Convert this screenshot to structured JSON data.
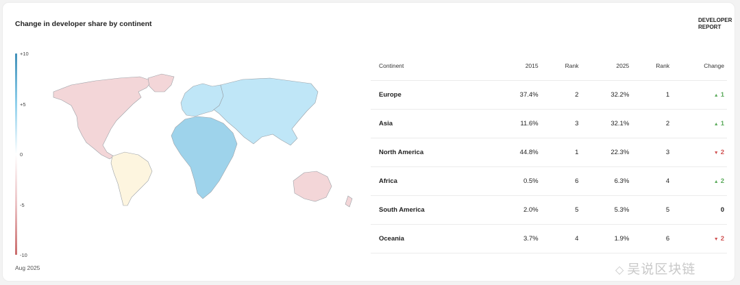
{
  "header": {
    "title": "Change in developer share by continent",
    "brand_line1": "DEVELOPER",
    "brand_line2": "REPORT"
  },
  "legend": {
    "ticks": [
      {
        "label": "+10",
        "value": 10
      },
      {
        "label": "+5",
        "value": 5
      },
      {
        "label": "0",
        "value": 0
      },
      {
        "label": "-5",
        "value": -5
      },
      {
        "label": "-10",
        "value": -10
      }
    ],
    "colors": {
      "positive": "#3f8fb8",
      "neutral": "#ffffff",
      "negative": "#c96a6a"
    }
  },
  "footer": {
    "date": "Aug 2025"
  },
  "watermark": {
    "text": "吴说区块链"
  },
  "chart_data": {
    "type": "table",
    "map_type": "choropleth",
    "columns": [
      "Continent",
      "2015",
      "Rank",
      "2025",
      "Rank",
      "Change"
    ],
    "rows": [
      {
        "continent": "Europe",
        "share_2015": "37.4%",
        "rank_2015": "2",
        "share_2025": "32.2%",
        "rank_2025": "1",
        "change": "1",
        "direction": "up",
        "fill": "#bfe6f7"
      },
      {
        "continent": "Asia",
        "share_2015": "11.6%",
        "rank_2015": "3",
        "share_2025": "32.1%",
        "rank_2025": "2",
        "change": "1",
        "direction": "up",
        "fill": "#bfe6f7"
      },
      {
        "continent": "North America",
        "share_2015": "44.8%",
        "rank_2015": "1",
        "share_2025": "22.3%",
        "rank_2025": "3",
        "change": "2",
        "direction": "down",
        "fill": "#f3d6d8"
      },
      {
        "continent": "Africa",
        "share_2015": "0.5%",
        "rank_2015": "6",
        "share_2025": "6.3%",
        "rank_2025": "4",
        "change": "2",
        "direction": "up",
        "fill": "#9ed3eb"
      },
      {
        "continent": "South America",
        "share_2015": "2.0%",
        "rank_2015": "5",
        "share_2025": "5.3%",
        "rank_2025": "5",
        "change": "0",
        "direction": "flat",
        "fill": "#fdf5df"
      },
      {
        "continent": "Oceania",
        "share_2015": "3.7%",
        "rank_2015": "4",
        "share_2025": "1.9%",
        "rank_2025": "6",
        "change": "2",
        "direction": "down",
        "fill": "#f3d6d8"
      }
    ]
  }
}
